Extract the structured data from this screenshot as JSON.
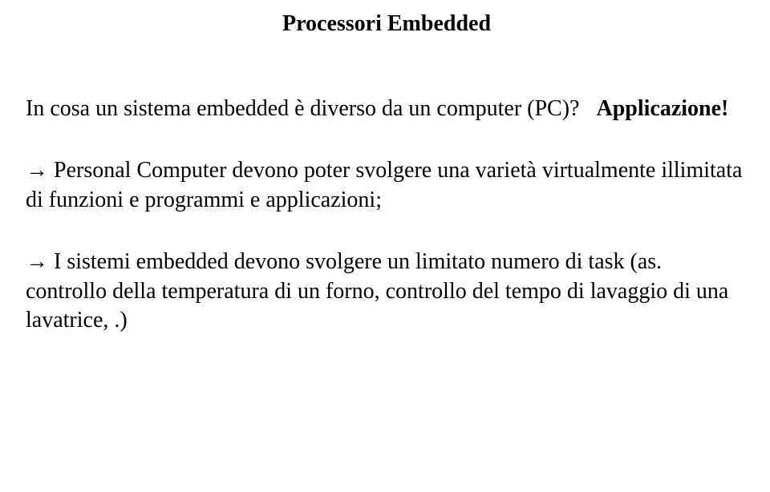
{
  "title": "Processori Embedded",
  "question": {
    "text": "In cosa un sistema embedded è diverso da un computer (PC)?",
    "emphasis": "Applicazione!"
  },
  "para1": "Personal Computer  devono poter svolgere una varietà virtualmente illimitata di funzioni e programmi e applicazioni;",
  "para2": "I sistemi embedded devono svolgere un limitato numero di task (as. controllo della temperatura di un forno, controllo del tempo di lavaggio di una lavatrice, .)",
  "arrow": "→"
}
